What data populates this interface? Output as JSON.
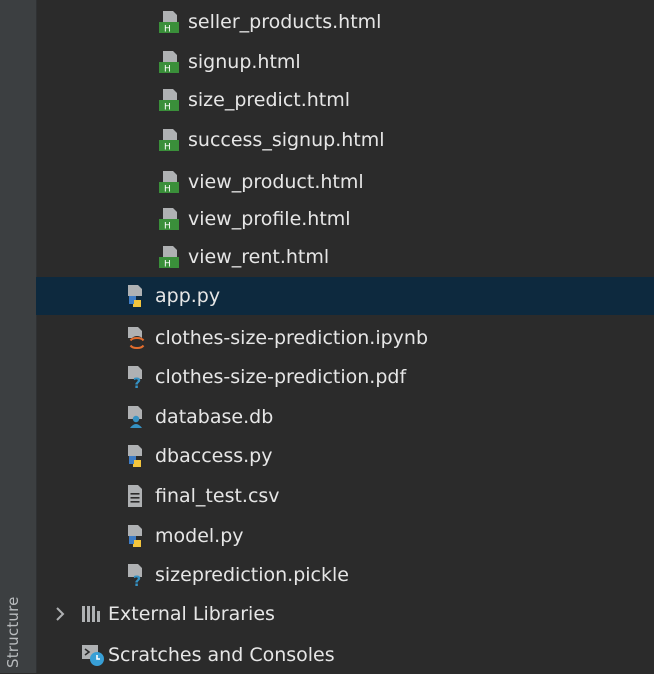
{
  "side_panel": {
    "label": "Structure"
  },
  "tree": {
    "items": [
      {
        "label": "seller_products.html",
        "icon": "html-file-icon"
      },
      {
        "label": "signup.html",
        "icon": "html-file-icon"
      },
      {
        "label": "size_predict.html",
        "icon": "html-file-icon"
      },
      {
        "label": "success_signup.html",
        "icon": "html-file-icon"
      },
      {
        "label": "view_product.html",
        "icon": "html-file-icon"
      },
      {
        "label": "view_profile.html",
        "icon": "html-file-icon"
      },
      {
        "label": "view_rent.html",
        "icon": "html-file-icon"
      },
      {
        "label": "app.py",
        "icon": "python-file-icon",
        "selected": true
      },
      {
        "label": "clothes-size-prediction.ipynb",
        "icon": "jupyter-file-icon"
      },
      {
        "label": "clothes-size-prediction.pdf",
        "icon": "unknown-file-icon"
      },
      {
        "label": "database.db",
        "icon": "database-file-icon"
      },
      {
        "label": "dbaccess.py",
        "icon": "python-file-icon"
      },
      {
        "label": "final_test.csv",
        "icon": "text-file-icon"
      },
      {
        "label": "model.py",
        "icon": "python-file-icon"
      },
      {
        "label": "sizeprediction.pickle",
        "icon": "unknown-file-icon"
      },
      {
        "label": "External Libraries",
        "icon": "libraries-icon"
      },
      {
        "label": "Scratches and Consoles",
        "icon": "scratches-icon"
      }
    ]
  },
  "colors": {
    "background": "#2b2b2b",
    "selection": "#0d293e",
    "html_badge": "#3a8f3a",
    "python_blue": "#3f7cc4",
    "python_yellow": "#f2c53d",
    "jupyter_orange": "#e46e2e",
    "unknown_blue": "#3592c4",
    "scratches_blue": "#389fd6",
    "file_gray": "#afb1b3"
  }
}
